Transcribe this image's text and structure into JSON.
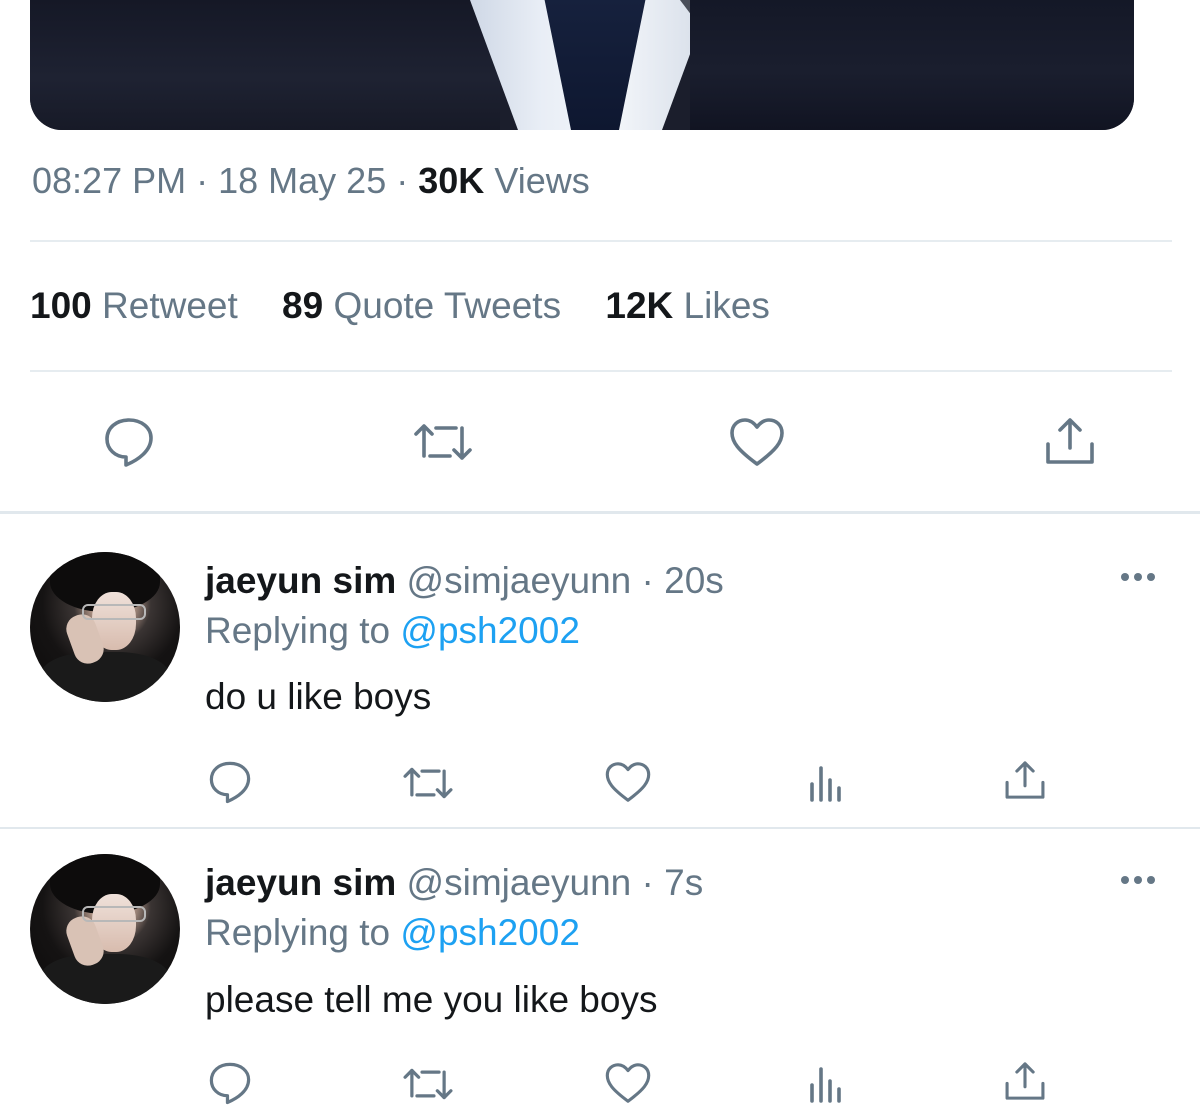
{
  "tweet": {
    "time": "08:27 PM",
    "date": "18 May 25",
    "views_count": "30K",
    "views_label": "Views",
    "sep": "·",
    "stats": {
      "retweets_count": "100",
      "retweets_label": "Retweet",
      "quotes_count": "89",
      "quotes_label": "Quote Tweets",
      "likes_count": "12K",
      "likes_label": "Likes"
    }
  },
  "replies": [
    {
      "name": "jaeyun sim",
      "handle": "@simjaeyunn",
      "time": "20s",
      "replying_prefix": "Replying to",
      "replying_to": "@psh2002",
      "text": "do u like boys"
    },
    {
      "name": "jaeyun sim",
      "handle": "@simjaeyunn",
      "time": "7s",
      "replying_prefix": "Replying to",
      "replying_to": "@psh2002",
      "text": "please tell me you like boys"
    }
  ],
  "icons": {
    "reply": "reply-bubble-icon",
    "retweet": "retweet-icon",
    "like": "heart-icon",
    "share": "share-icon",
    "analytics": "analytics-icon",
    "more": "more-dots-icon"
  },
  "colors": {
    "text": "#14171a",
    "secondary": "#657786",
    "link": "#1da1f2",
    "divider": "#e6ecf0"
  }
}
